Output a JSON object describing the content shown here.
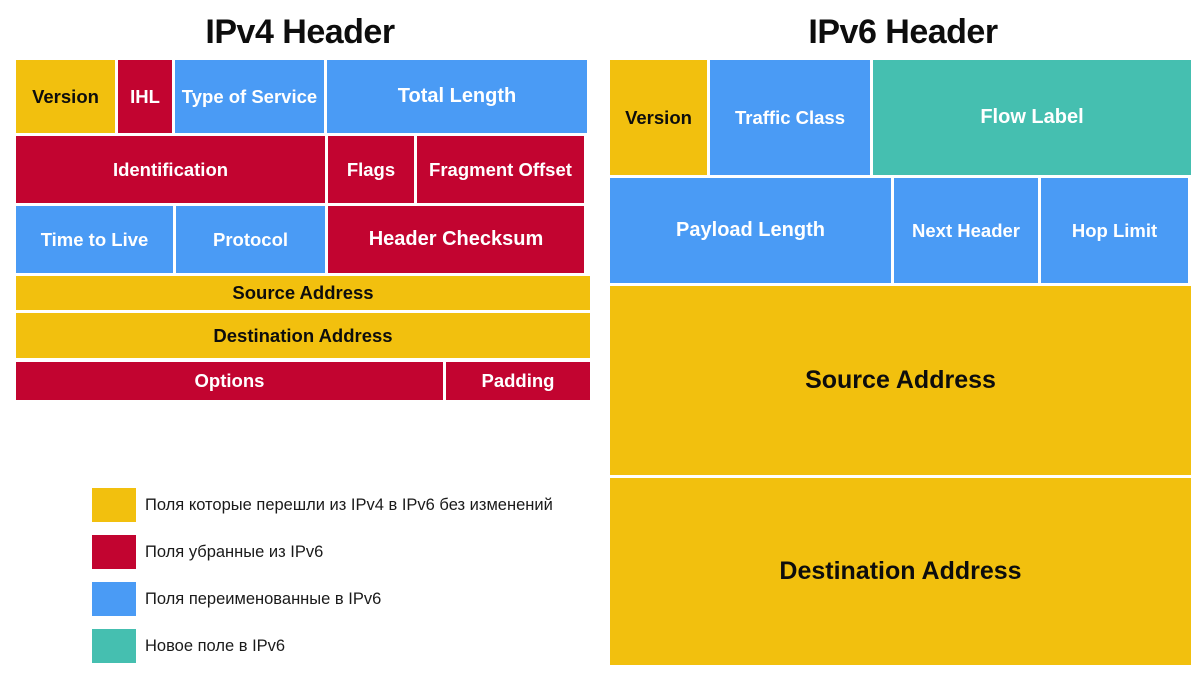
{
  "colors": {
    "unchanged": "#F2C00E",
    "removed": "#C20430",
    "renamed": "#4A9BF5",
    "new": "#45BFB0",
    "background": "#FFFFFF",
    "text_dark": "#0D0D0D",
    "text_light": "#FFFFFF"
  },
  "ipv4": {
    "title": "IPv4 Header",
    "rows": [
      {
        "cells": [
          {
            "label": "Version",
            "type": "unchanged"
          },
          {
            "label": "IHL",
            "type": "removed"
          },
          {
            "label": "Type of Service",
            "type": "renamed"
          },
          {
            "label": "Total Length",
            "type": "renamed"
          }
        ]
      },
      {
        "cells": [
          {
            "label": "Identification",
            "type": "removed"
          },
          {
            "label": "Flags",
            "type": "removed"
          },
          {
            "label": "Fragment Offset",
            "type": "removed"
          }
        ]
      },
      {
        "cells": [
          {
            "label": "Time to Live",
            "type": "renamed"
          },
          {
            "label": "Protocol",
            "type": "renamed"
          },
          {
            "label": "Header Checksum",
            "type": "removed"
          }
        ]
      },
      {
        "cells": [
          {
            "label": "Source Address",
            "type": "unchanged"
          }
        ]
      },
      {
        "cells": [
          {
            "label": "Destination Address",
            "type": "unchanged"
          }
        ]
      },
      {
        "cells": [
          {
            "label": "Options",
            "type": "removed"
          },
          {
            "label": "Padding",
            "type": "removed"
          }
        ]
      }
    ]
  },
  "ipv6": {
    "title": "IPv6 Header",
    "rows": [
      {
        "cells": [
          {
            "label": "Version",
            "type": "unchanged"
          },
          {
            "label": "Traffic Class",
            "type": "renamed"
          },
          {
            "label": "Flow Label",
            "type": "new"
          }
        ]
      },
      {
        "cells": [
          {
            "label": "Payload Length",
            "type": "renamed"
          },
          {
            "label": "Next Header",
            "type": "renamed"
          },
          {
            "label": "Hop Limit",
            "type": "renamed"
          }
        ]
      },
      {
        "cells": [
          {
            "label": "Source Address",
            "type": "unchanged"
          }
        ]
      },
      {
        "cells": [
          {
            "label": "Destination Address",
            "type": "unchanged"
          }
        ]
      }
    ]
  },
  "legend": {
    "items": [
      {
        "color": "#F2C00E",
        "label": "Поля которые перешли из IPv4 в IPv6 без изменений"
      },
      {
        "color": "#C20430",
        "label": "Поля убранные из IPv6"
      },
      {
        "color": "#4A9BF5",
        "label": "Поля переименованные в IPv6"
      },
      {
        "color": "#45BFB0",
        "label": "Новое поле в IPv6"
      }
    ]
  }
}
